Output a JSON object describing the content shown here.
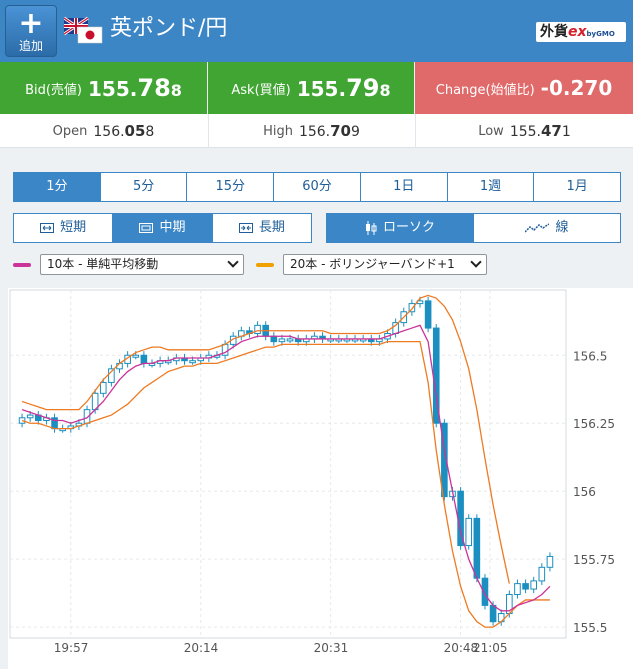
{
  "header": {
    "add_button_label": "追加",
    "pair_name": "英ポンド/円",
    "logo_text_main": "外貨",
    "logo_text_ex": "ex",
    "logo_text_sub": "byGMO"
  },
  "prices": {
    "bid_label": "Bid(売値)",
    "bid_prefix": "155.",
    "bid_large": "78",
    "bid_small": "8",
    "ask_label": "Ask(買値)",
    "ask_prefix": "155.",
    "ask_large": "79",
    "ask_small": "8",
    "change_label": "Change(始値比)",
    "change_value": "-0.270"
  },
  "ohl": {
    "open_label": "Open",
    "open_prefix": "156.",
    "open_large": "05",
    "open_small": "8",
    "high_label": "High",
    "high_prefix": "156.",
    "high_large": "70",
    "high_small": "9",
    "low_label": "Low",
    "low_prefix": "155.",
    "low_large": "47",
    "low_small": "1"
  },
  "timeframes": [
    "1分",
    "5分",
    "15分",
    "60分",
    "1日",
    "1週",
    "1月"
  ],
  "active_timeframe": "1分",
  "ranges": [
    "短期",
    "中期",
    "長期"
  ],
  "active_range": "中期",
  "chart_types": [
    "ローソク",
    "線"
  ],
  "active_chart_type": "ローソク",
  "indicators": {
    "ma": {
      "label": "10本 - 単純平均移動",
      "color": "#cc3399"
    },
    "bb": {
      "label": "20本 - ボリンジャーバンド+1",
      "color": "#f0a000"
    }
  },
  "colors": {
    "header_bg": "#3c86c6",
    "bid_bg": "#41a534",
    "change_bg": "#e06a6a",
    "candle": "#1a8fc0",
    "ma_line": "#cc3399",
    "band_line": "#ee7a22"
  },
  "chart_data": {
    "type": "candlestick",
    "x_labels": [
      "19:57",
      "20:14",
      "20:31",
      "20:48",
      "21:05"
    ],
    "y_ticks": [
      "156.5",
      "156.25",
      "156",
      "155.75",
      "155.5"
    ],
    "y_tick_values": [
      156.5,
      156.25,
      156.0,
      155.75,
      155.5
    ],
    "ylim": [
      155.46,
      156.74
    ],
    "grid": true,
    "closes": [
      156.27,
      156.28,
      156.26,
      156.27,
      156.23,
      156.23,
      156.24,
      156.25,
      156.3,
      156.36,
      156.4,
      156.45,
      156.47,
      156.5,
      156.5,
      156.47,
      156.47,
      156.48,
      156.48,
      156.49,
      156.48,
      156.48,
      156.49,
      156.5,
      156.5,
      156.54,
      156.57,
      156.59,
      156.58,
      156.61,
      156.57,
      156.55,
      156.56,
      156.56,
      156.55,
      156.56,
      156.57,
      156.56,
      156.56,
      156.56,
      156.56,
      156.56,
      156.56,
      156.55,
      156.56,
      156.58,
      156.62,
      156.66,
      156.69,
      156.7,
      156.6,
      156.25,
      155.98,
      156.0,
      155.8,
      155.9,
      155.68,
      155.58,
      155.52,
      155.55,
      155.62,
      155.66,
      155.64,
      155.67,
      155.72,
      155.76
    ],
    "ma10": [
      156.3,
      156.29,
      156.28,
      156.27,
      156.26,
      156.26,
      156.25,
      156.26,
      156.27,
      156.3,
      156.33,
      156.37,
      156.41,
      156.44,
      156.46,
      156.47,
      156.47,
      156.48,
      156.48,
      156.49,
      156.49,
      156.49,
      156.49,
      156.49,
      156.5,
      156.51,
      156.53,
      156.55,
      156.56,
      156.57,
      156.57,
      156.57,
      156.57,
      156.57,
      156.56,
      156.56,
      156.56,
      156.56,
      156.56,
      156.56,
      156.56,
      156.56,
      156.56,
      156.56,
      156.56,
      156.57,
      156.58,
      156.59,
      156.6,
      156.61,
      156.55,
      156.35,
      156.15,
      156.0,
      155.85,
      155.75,
      155.68,
      155.62,
      155.58,
      155.56,
      155.56,
      155.58,
      155.59,
      155.6,
      155.62,
      155.65
    ],
    "bb_upper": [
      156.33,
      156.32,
      156.31,
      156.3,
      156.3,
      156.3,
      156.3,
      156.3,
      156.33,
      156.37,
      156.41,
      156.44,
      156.47,
      156.49,
      156.51,
      156.52,
      156.53,
      156.53,
      156.52,
      156.52,
      156.52,
      156.52,
      156.52,
      156.52,
      156.53,
      156.54,
      156.56,
      156.57,
      156.58,
      156.59,
      156.59,
      156.59,
      156.59,
      156.59,
      156.59,
      156.59,
      156.59,
      156.59,
      156.58,
      156.58,
      156.58,
      156.58,
      156.58,
      156.58,
      156.58,
      156.59,
      156.61,
      156.64,
      156.67,
      156.71,
      156.72,
      156.71,
      156.68,
      156.63,
      156.55,
      156.45,
      156.3,
      156.12,
      155.95,
      155.8,
      155.66
    ],
    "bb_lower": [
      156.26,
      156.25,
      156.25,
      156.24,
      156.23,
      156.23,
      156.23,
      156.24,
      156.25,
      156.26,
      156.27,
      156.28,
      156.3,
      156.32,
      156.35,
      156.38,
      156.4,
      156.42,
      156.44,
      156.45,
      156.46,
      156.46,
      156.47,
      156.47,
      156.47,
      156.48,
      156.49,
      156.5,
      156.51,
      156.52,
      156.53,
      156.53,
      156.54,
      156.54,
      156.54,
      156.54,
      156.54,
      156.54,
      156.54,
      156.54,
      156.54,
      156.54,
      156.54,
      156.54,
      156.54,
      156.55,
      156.55,
      156.55,
      156.55,
      156.55,
      156.4,
      156.15,
      155.95,
      155.78,
      155.65,
      155.56,
      155.52,
      155.5,
      155.5,
      155.52,
      155.55,
      155.58,
      155.6,
      155.6,
      155.6,
      155.6
    ]
  }
}
